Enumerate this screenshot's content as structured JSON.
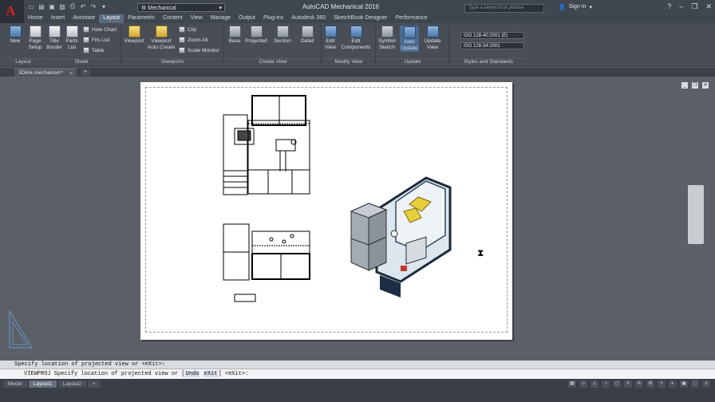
{
  "app": {
    "title": "AutoCAD Mechanical 2016",
    "workspace": "Mechanical",
    "search_placeholder": "Type a keyword or phrase",
    "sign_in": "Sign In"
  },
  "tabs": [
    "Home",
    "Insert",
    "Annotate",
    "Layout",
    "Parametric",
    "Content",
    "View",
    "Manage",
    "Output",
    "Plug-ins",
    "Autodesk 360",
    "SketchBook Designer",
    "Performance"
  ],
  "active_tab": "Layout",
  "ribbon": {
    "new": "New",
    "page_setup": "Page\nSetup",
    "title_border": "Title\nBorder",
    "parts_list": "Parts\nList",
    "hole_chart": "Hole Chart",
    "fits_list": "Fits List",
    "table": "Table",
    "viewport": "Viewport",
    "viewport_auto_create": "Viewport\nAuto Create",
    "clip": "Clip",
    "zoom_all": "Zoom All",
    "scale_monitor": "Scale Monitor",
    "base": "Base",
    "projected": "Projected",
    "section": "Section",
    "detail": "Detail",
    "edit_view": "Edit\nView",
    "edit_components": "Edit\nComponents",
    "symbol_sketch": "Symbol\nSketch",
    "auto_update": "Auto\nUpdate",
    "update_view": "Update\nView",
    "style1": "ISO 128-40:2001 (E)",
    "style2": "ISO 128-34:2001",
    "groups": {
      "layout": "Layout",
      "sheet": "Sheet",
      "viewports": "Viewports",
      "create_view": "Create View",
      "modify_view": "Modify View",
      "update": "Update",
      "styles": "Styles and Standards"
    }
  },
  "document_tab": "3Dlink-mechanism*",
  "command": {
    "history": "Specify location of projected view or <eXit>:",
    "prompt_prefix": "VIEWPROJ Specify location of projected view or [",
    "option1": "Undo",
    "option2": "eXit",
    "prompt_suffix": "] <eXit>:"
  },
  "layout_tabs": [
    "Model",
    "Layout1",
    "Layout2"
  ],
  "active_layout": "Layout1"
}
